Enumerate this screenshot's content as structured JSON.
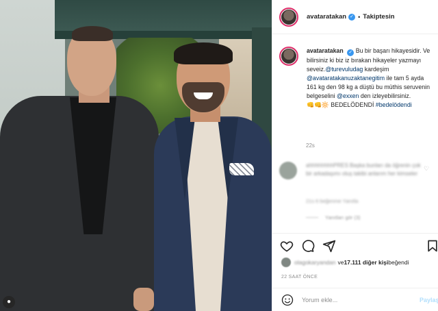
{
  "post": {
    "username": "avataratakan",
    "follow_status": "Takiptesin",
    "separator": "•"
  },
  "caption": {
    "username": "avataratakan",
    "text_1": "Bu bir başarı hikayesidir. Ve bilirsiniz ki biz iz bırakan hikayeler yazmayı seveiz.",
    "mention_1": "@turevuludag",
    "text_2": " kardeşim ",
    "mention_2": "@avataratakanuzaktanegitim",
    "text_3": " ile tam 5 ayda 161 kg den 98 kg a düştü bu müthis seruvenin belgeselini ",
    "mention_3": "@exxen",
    "text_4": " den izleyebilirsiniz.",
    "emoji_line_text": "BEDELÖDENDİ",
    "hashtag": "#bedelödendi",
    "time": "22s"
  },
  "comment": {
    "blurred_text": "ahhhhhhhhPRES Başka bunları da öğrenin çok bir arkadaşımı oluş takibi anlarım her kimseler",
    "meta": "21s 6 beğenme Yanıtla",
    "more": "Yanıtları gör (3)"
  },
  "likes": {
    "blurred_name": "olagokaryandan",
    "text_prefix": "ve ",
    "count": "17.111 diğer kişi",
    "text_suffix": " beğendi"
  },
  "date": "22 SAAT ÖNCE",
  "add_comment": {
    "placeholder": "Yorum ekle...",
    "post_label": "Paylaş"
  },
  "icons": {
    "heart": "heart-icon",
    "comment": "comment-icon",
    "share": "share-icon",
    "save": "bookmark-icon",
    "emoji": "emoji-icon",
    "verified": "verified-badge-icon"
  },
  "colors": {
    "link": "#00376b",
    "verified": "#3897f0",
    "muted": "#8e8e8e",
    "post_button": "#b2dffc"
  }
}
